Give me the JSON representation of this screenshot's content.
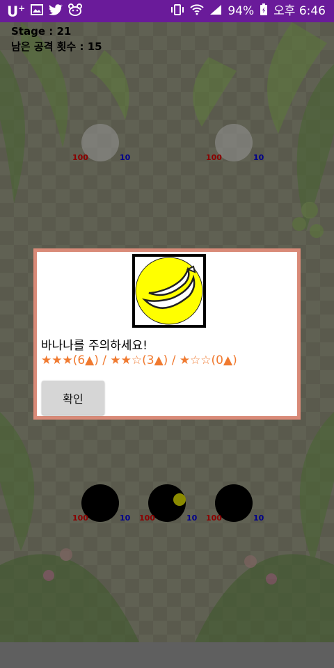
{
  "status_bar": {
    "carrier": "U",
    "battery": "94%",
    "time": "오후 6:46",
    "icons": [
      "uplus-icon",
      "image-icon",
      "twitter-icon",
      "bear-icon",
      "vibrate-icon",
      "wifi-icon",
      "signal-icon",
      "battery-icon"
    ]
  },
  "hud": {
    "stage": "Stage : 21",
    "attacks_left": "남은 공격 횟수 : 15"
  },
  "holes": [
    {
      "state": "empty",
      "red": "100",
      "blue": "10"
    },
    {
      "state": "empty",
      "red": "100",
      "blue": "10"
    },
    {
      "state": "filled",
      "red": "100",
      "blue": "10"
    },
    {
      "state": "filled",
      "red": "100",
      "blue": "10",
      "pebble": true
    },
    {
      "state": "filled",
      "red": "100",
      "blue": "10"
    }
  ],
  "dialog": {
    "image": "banana-icon",
    "message": "바나나를 주의하세요!",
    "stars": "★★★(6▲) / ★★☆(3▲) / ★☆☆(0▲)",
    "confirm": "확인"
  },
  "colors": {
    "status_bar": "#6a1b9a",
    "dialog_border": "#d98a78",
    "stars": "#f07a30",
    "banana_bg": "#ffff00"
  }
}
